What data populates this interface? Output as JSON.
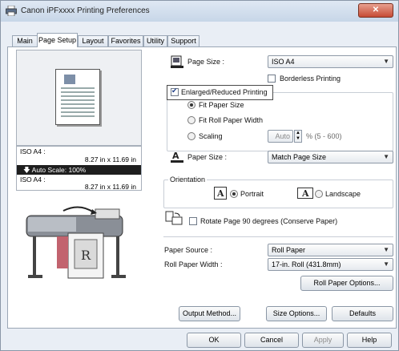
{
  "window": {
    "title": "Canon iPFxxxx Printing Preferences",
    "close_label": "✕"
  },
  "tabs": [
    "Main",
    "Page Setup",
    "Layout",
    "Favorites",
    "Utility",
    "Support"
  ],
  "preview_info": {
    "line1_label": "ISO A4 :",
    "line1_dim": "8.27 in x 11.69 in",
    "auto_scale": "Auto Scale: 100%",
    "line2_label": "ISO A4 :",
    "line2_dim": "8.27 in x 11.69 in"
  },
  "page_size": {
    "label": "Page Size :",
    "value": "ISO A4"
  },
  "borderless": {
    "label": "Borderless Printing",
    "checked": false
  },
  "enlarged": {
    "label": "Enlarged/Reduced Printing",
    "checked": true
  },
  "fit_options": {
    "fit_paper": "Fit Paper Size",
    "fit_roll": "Fit Roll Paper Width",
    "scaling": "Scaling",
    "scaling_value": "Auto",
    "scaling_range": "% (5 - 600)"
  },
  "paper_size": {
    "label": "Paper Size :",
    "value": "Match Page Size"
  },
  "orientation": {
    "label": "Orientation",
    "portrait": "Portrait",
    "landscape": "Landscape"
  },
  "rotate": {
    "label": "Rotate Page 90 degrees (Conserve Paper)",
    "checked": false
  },
  "paper_source": {
    "label": "Paper Source :",
    "value": "Roll Paper"
  },
  "roll_width": {
    "label": "Roll Paper Width :",
    "value": "17-in. Roll (431.8mm)"
  },
  "buttons": {
    "roll_options": "Roll Paper Options...",
    "output_method": "Output Method...",
    "size_options": "Size Options...",
    "defaults": "Defaults",
    "ok": "OK",
    "cancel": "Cancel",
    "apply": "Apply",
    "help": "Help"
  }
}
